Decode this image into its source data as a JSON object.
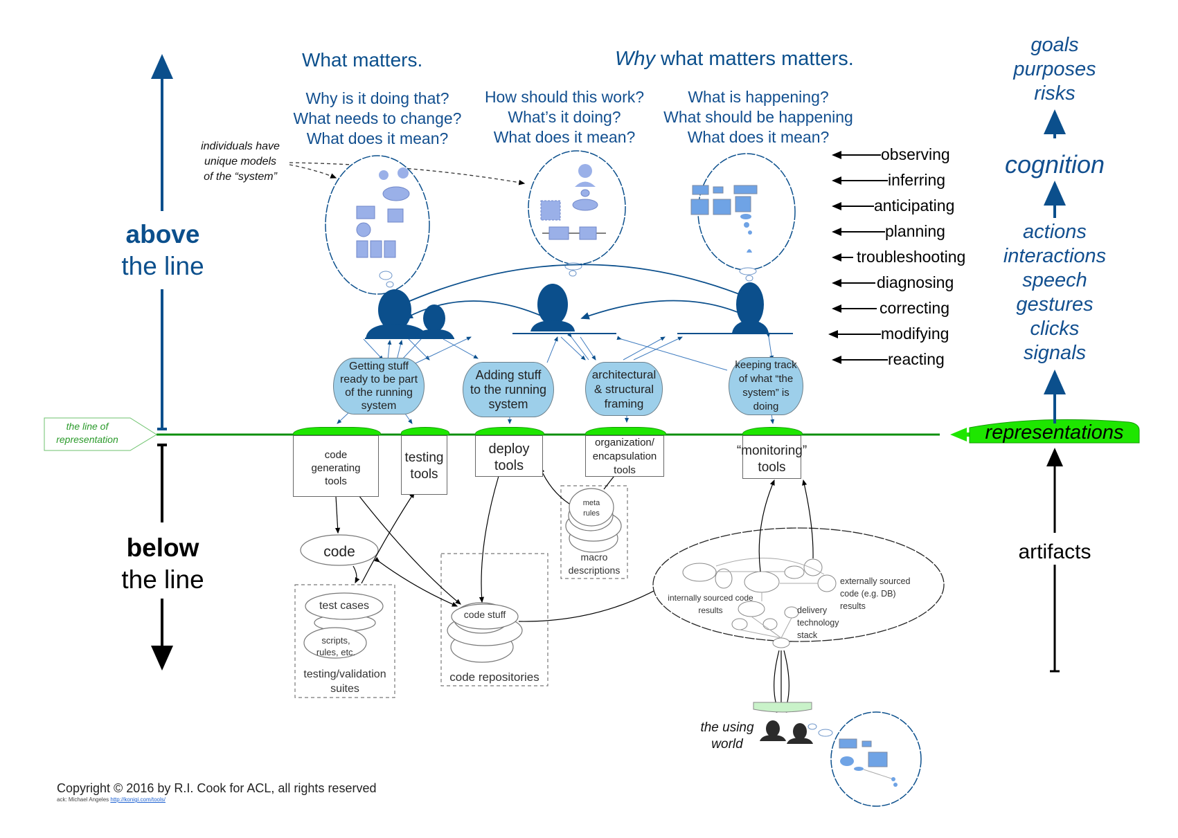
{
  "colors": {
    "accent_blue": "#0b4f8c",
    "bubble_fill": "#9ab0e8",
    "process_fill": "#9dcfea",
    "line_green": "#0d8f0d",
    "rep_green": "#1ee600",
    "using_world_fill": "#c9f2c9"
  },
  "headers": {
    "what_matters": "What matters.",
    "why_word": "Why",
    "why_rest": " what matters matters."
  },
  "question_columns": [
    [
      "Why is it doing that?",
      "What needs to change?",
      "What does it mean?"
    ],
    [
      "How should this work?",
      "What’s it doing?",
      "What does it mean?"
    ],
    [
      "What is happening?",
      "What should be happening",
      "What does it mean?"
    ]
  ],
  "annotation": {
    "individuals": [
      "individuals have",
      "unique models",
      "of the “system”"
    ]
  },
  "left_axis": {
    "above_bold": "above",
    "above_rest": "the line",
    "below_bold": "below",
    "below_rest": "the line",
    "line_label": [
      "the line of",
      "representation"
    ]
  },
  "cognitive_verbs": [
    "observing",
    "inferring",
    "anticipating",
    "planning",
    "troubleshooting",
    "diagnosing",
    "correcting",
    "modifying",
    "reacting"
  ],
  "right_axis": {
    "top": [
      "goals",
      "purposes",
      "risks"
    ],
    "cognition": "cognition",
    "middle": [
      "actions",
      "interactions",
      "speech",
      "gestures",
      "clicks",
      "signals"
    ],
    "representations": "representations",
    "artifacts": "artifacts"
  },
  "processes": [
    {
      "label": [
        "Getting stuff",
        "ready to be part",
        "of the running",
        "system"
      ]
    },
    {
      "label": [
        "Adding stuff",
        "to the running",
        "system"
      ]
    },
    {
      "label": [
        "architectural",
        "& structural",
        "framing"
      ]
    },
    {
      "label": [
        "keeping track",
        "of what “the",
        "system” is",
        "doing"
      ]
    }
  ],
  "tools": [
    {
      "label": [
        "code",
        "generating",
        "tools"
      ]
    },
    {
      "label": [
        "testing",
        "tools"
      ]
    },
    {
      "label": [
        "deploy",
        "tools"
      ]
    },
    {
      "label": [
        "organization/",
        "encapsulation",
        "tools"
      ]
    },
    {
      "label": [
        "“monitoring”",
        "tools"
      ]
    }
  ],
  "below": {
    "code": "code",
    "test_cases": "test cases",
    "scripts": [
      "scripts,",
      "rules, etc."
    ],
    "testing_suites": [
      "testing/validation",
      "suites"
    ],
    "code_stuff": "code stuff",
    "code_repositories": "code repositories",
    "meta_rules": [
      "meta",
      "rules"
    ],
    "macro_descriptions": [
      "macro",
      "descriptions"
    ],
    "internally_sourced": [
      "internally sourced code",
      "results"
    ],
    "externally_sourced": [
      "externally sourced",
      "code (e.g. DB)",
      "results"
    ],
    "delivery_stack": [
      "delivery",
      "technology",
      "stack"
    ],
    "using_world": [
      "the using",
      "world"
    ]
  },
  "footer": {
    "copyright": "Copyright © 2016 by R.I. Cook for ACL, all rights reserved",
    "ack": "ack: Michael Angeles ",
    "ack_link": "http://konigi.com/tools/"
  }
}
